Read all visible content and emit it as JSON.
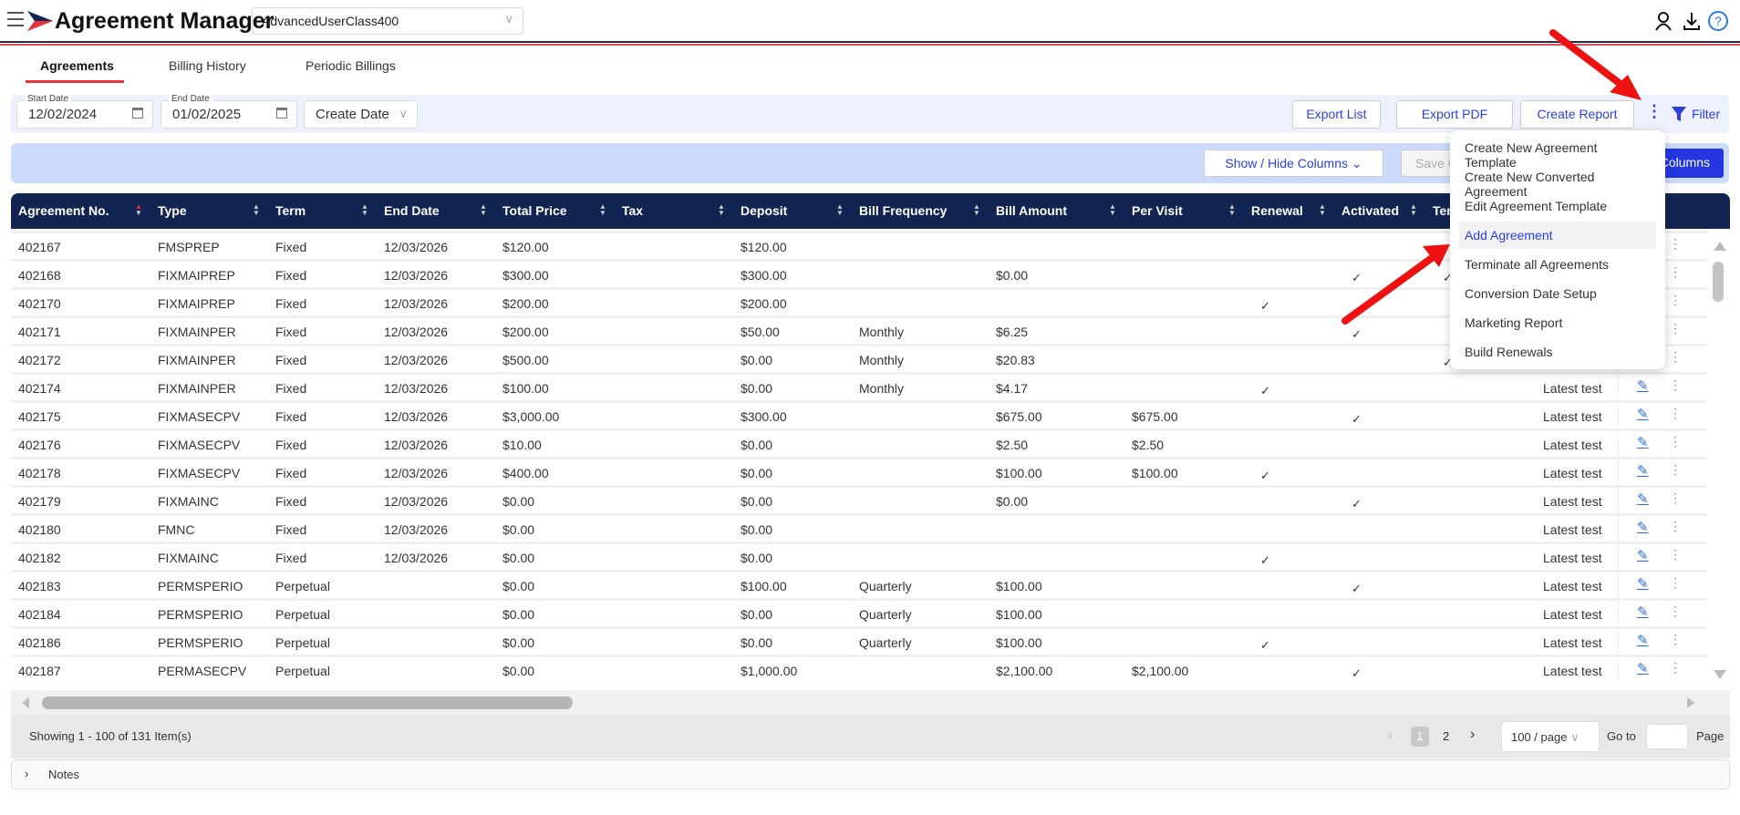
{
  "header": {
    "title": "Agreement Manager",
    "account": "AdvancedUserClass400"
  },
  "tabs": [
    {
      "label": "Agreements",
      "active": true
    },
    {
      "label": "Billing History"
    },
    {
      "label": "Periodic Billings"
    }
  ],
  "filters": {
    "start_label": "Start Date",
    "start_value": "12/02/2024",
    "end_label": "End Date",
    "end_value": "01/02/2025",
    "date_type": "Create Date"
  },
  "toolbar": {
    "export_list": "Export List",
    "export_pdf": "Export PDF",
    "create_report": "Create Report",
    "filter": "Filter"
  },
  "columns_bar": {
    "show_hide": "Show / Hide Columns",
    "save": "Save Columns",
    "reset": "Reset Columns"
  },
  "table": {
    "headers": [
      "Agreement No.",
      "Type",
      "Term",
      "End Date",
      "Total Price",
      "Tax",
      "Deposit",
      "Bill Frequency",
      "Bill Amount",
      "Per Visit",
      "Renewal",
      "Activated",
      "Terminated",
      "",
      "Actions"
    ],
    "rows": [
      {
        "no": "402167",
        "type": "FMSPREP",
        "term": "Fixed",
        "end": "12/03/2026",
        "total": "$120.00",
        "tax": "",
        "deposit": "$120.00",
        "freq": "",
        "bill": "",
        "visit": "",
        "renewal": false,
        "activated": false,
        "ter": false,
        "note": "Latest test"
      },
      {
        "no": "402168",
        "type": "FIXMAIPREP",
        "term": "Fixed",
        "end": "12/03/2026",
        "total": "$300.00",
        "tax": "",
        "deposit": "$300.00",
        "freq": "",
        "bill": "$0.00",
        "visit": "",
        "renewal": false,
        "activated": true,
        "ter": true,
        "note": "Latest test"
      },
      {
        "no": "402170",
        "type": "FIXMAIPREP",
        "term": "Fixed",
        "end": "12/03/2026",
        "total": "$200.00",
        "tax": "",
        "deposit": "$200.00",
        "freq": "",
        "bill": "",
        "visit": "",
        "renewal": true,
        "activated": false,
        "ter": false,
        "note": "Latest test"
      },
      {
        "no": "402171",
        "type": "FIXMAINPER",
        "term": "Fixed",
        "end": "12/03/2026",
        "total": "$200.00",
        "tax": "",
        "deposit": "$50.00",
        "freq": "Monthly",
        "bill": "$6.25",
        "visit": "",
        "renewal": false,
        "activated": true,
        "ter": false,
        "note": "Latest test"
      },
      {
        "no": "402172",
        "type": "FIXMAINPER",
        "term": "Fixed",
        "end": "12/03/2026",
        "total": "$500.00",
        "tax": "",
        "deposit": "$0.00",
        "freq": "Monthly",
        "bill": "$20.83",
        "visit": "",
        "renewal": false,
        "activated": false,
        "ter": true,
        "note": "Latest test"
      },
      {
        "no": "402174",
        "type": "FIXMAINPER",
        "term": "Fixed",
        "end": "12/03/2026",
        "total": "$100.00",
        "tax": "",
        "deposit": "$0.00",
        "freq": "Monthly",
        "bill": "$4.17",
        "visit": "",
        "renewal": true,
        "activated": false,
        "ter": false,
        "note": "Latest test"
      },
      {
        "no": "402175",
        "type": "FIXMASECPV",
        "term": "Fixed",
        "end": "12/03/2026",
        "total": "$3,000.00",
        "tax": "",
        "deposit": "$300.00",
        "freq": "",
        "bill": "$675.00",
        "visit": "$675.00",
        "renewal": false,
        "activated": true,
        "ter": false,
        "note": "Latest test"
      },
      {
        "no": "402176",
        "type": "FIXMASECPV",
        "term": "Fixed",
        "end": "12/03/2026",
        "total": "$10.00",
        "tax": "",
        "deposit": "$0.00",
        "freq": "",
        "bill": "$2.50",
        "visit": "$2.50",
        "renewal": false,
        "activated": false,
        "ter": false,
        "note": "Latest test"
      },
      {
        "no": "402178",
        "type": "FIXMASECPV",
        "term": "Fixed",
        "end": "12/03/2026",
        "total": "$400.00",
        "tax": "",
        "deposit": "$0.00",
        "freq": "",
        "bill": "$100.00",
        "visit": "$100.00",
        "renewal": true,
        "activated": false,
        "ter": false,
        "note": "Latest test"
      },
      {
        "no": "402179",
        "type": "FIXMAINC",
        "term": "Fixed",
        "end": "12/03/2026",
        "total": "$0.00",
        "tax": "",
        "deposit": "$0.00",
        "freq": "",
        "bill": "$0.00",
        "visit": "",
        "renewal": false,
        "activated": true,
        "ter": false,
        "note": "Latest test"
      },
      {
        "no": "402180",
        "type": "FMNC",
        "term": "Fixed",
        "end": "12/03/2026",
        "total": "$0.00",
        "tax": "",
        "deposit": "$0.00",
        "freq": "",
        "bill": "",
        "visit": "",
        "renewal": false,
        "activated": false,
        "ter": false,
        "note": "Latest test"
      },
      {
        "no": "402182",
        "type": "FIXMAINC",
        "term": "Fixed",
        "end": "12/03/2026",
        "total": "$0.00",
        "tax": "",
        "deposit": "$0.00",
        "freq": "",
        "bill": "",
        "visit": "",
        "renewal": true,
        "activated": false,
        "ter": false,
        "note": "Latest test"
      },
      {
        "no": "402183",
        "type": "PERMSPERIO",
        "term": "Perpetual",
        "end": "",
        "total": "$0.00",
        "tax": "",
        "deposit": "$100.00",
        "freq": "Quarterly",
        "bill": "$100.00",
        "visit": "",
        "renewal": false,
        "activated": true,
        "ter": false,
        "note": "Latest test"
      },
      {
        "no": "402184",
        "type": "PERMSPERIO",
        "term": "Perpetual",
        "end": "",
        "total": "$0.00",
        "tax": "",
        "deposit": "$0.00",
        "freq": "Quarterly",
        "bill": "$100.00",
        "visit": "",
        "renewal": false,
        "activated": false,
        "ter": false,
        "note": "Latest test"
      },
      {
        "no": "402186",
        "type": "PERMSPERIO",
        "term": "Perpetual",
        "end": "",
        "total": "$0.00",
        "tax": "",
        "deposit": "$0.00",
        "freq": "Quarterly",
        "bill": "$100.00",
        "visit": "",
        "renewal": true,
        "activated": false,
        "ter": false,
        "note": "Latest test"
      },
      {
        "no": "402187",
        "type": "PERMASECPV",
        "term": "Perpetual",
        "end": "",
        "total": "$0.00",
        "tax": "",
        "deposit": "$1,000.00",
        "freq": "",
        "bill": "$2,100.00",
        "visit": "$2,100.00",
        "renewal": false,
        "activated": true,
        "ter": false,
        "note": "Latest test"
      }
    ]
  },
  "pagination": {
    "summary": "Showing 1 - 100 of 131 Item(s)",
    "pages": [
      "1",
      "2"
    ],
    "current": "1",
    "page_size": "100 / page",
    "goto": "Go to",
    "page": "Page"
  },
  "notes": {
    "label": "Notes"
  },
  "menu": {
    "items": [
      "Create New Agreement Template",
      "Create New Converted Agreement",
      "Edit Agreement Template",
      "Add Agreement",
      "Terminate all Agreements",
      "Conversion Date Setup",
      "Marketing Report",
      "Build Renewals"
    ],
    "highlighted": "Add Agreement"
  },
  "colors": {
    "header": "#122452",
    "accent": "#2a3fe0",
    "red": "#e8323c",
    "annotation_arrow": "#ee1111"
  }
}
